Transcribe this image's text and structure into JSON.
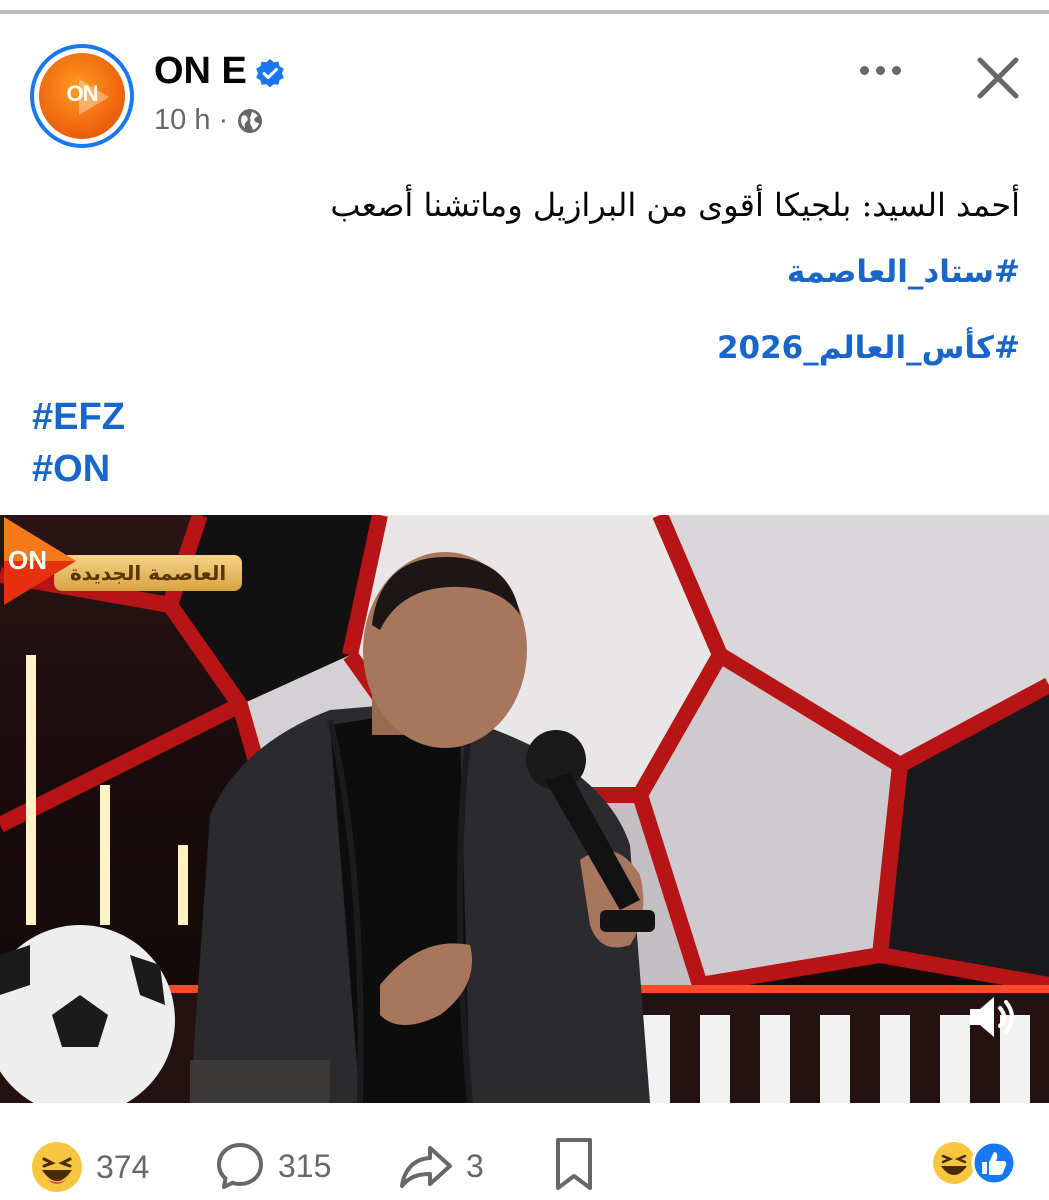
{
  "post": {
    "page_name": "ON E",
    "time": "10 h",
    "separator": "·",
    "avatar_text": "ON",
    "text": "أحمد السيد: بلجيكا أقوى من البرازيل وماتشنا أصعب",
    "hashtags_ar": [
      "#ستاد_العاصمة",
      "#كأس_العالم_2026"
    ],
    "hashtags_en": [
      "#EFZ",
      "#ON"
    ]
  },
  "media": {
    "location_badge": "العاصمة الجديدة",
    "channel_logo": "ON"
  },
  "footer": {
    "reaction_count": "374",
    "comment_count": "315",
    "share_count": "3"
  },
  "icons": {
    "verified": "verified-badge-icon",
    "audience": "globe-icon",
    "more": "more-options-icon",
    "close": "close-icon",
    "volume": "volume-icon",
    "reaction": "haha-emoji-icon",
    "comment": "comment-icon",
    "share": "share-icon",
    "save": "bookmark-icon"
  },
  "colors": {
    "link": "#1866c8",
    "verified": "#1877f2",
    "muted": "#65676b",
    "brand_orange": "#f26b0f"
  }
}
